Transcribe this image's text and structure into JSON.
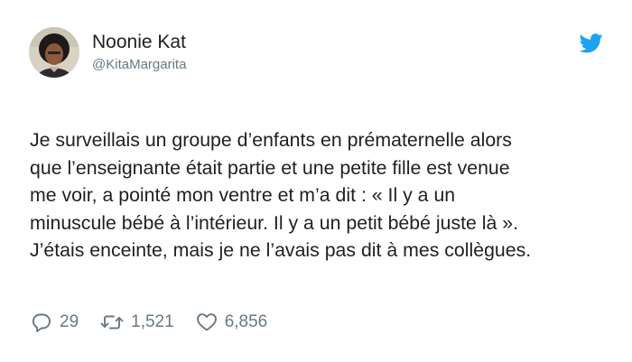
{
  "tweet": {
    "author_name": "Noonie Kat",
    "author_handle": "@KitaMargarita",
    "text_lines": [
      "Je surveillais un groupe d’enfants en prématernelle alors",
      "que l’enseignante était partie et une petite fille est venue",
      "me voir, a pointé mon ventre et m’a dit : « Il y a un",
      "minuscule bébé à l’intérieur. Il y a un petit bébé juste là ».",
      "J’étais enceinte, mais je ne l’avais pas dit à mes collègues."
    ],
    "replies": "29",
    "retweets": "1,521",
    "likes": "6,856"
  },
  "icons": {
    "brand": "twitter-bird-icon",
    "reply": "reply-icon",
    "retweet": "retweet-icon",
    "like": "heart-icon"
  },
  "colors": {
    "twitter_blue": "#1da1f2",
    "secondary_text": "#697882"
  }
}
